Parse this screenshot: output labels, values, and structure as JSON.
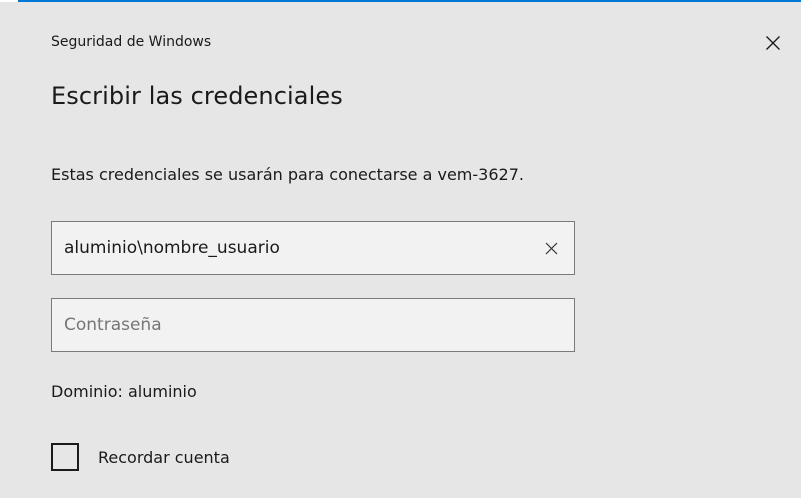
{
  "window": {
    "title": "Seguridad de Windows",
    "accent_color": "#0078d7",
    "close_icon": "close-icon"
  },
  "dialog": {
    "heading": "Escribir las credenciales",
    "description": "Estas credenciales se usarán para conectarse a vem-3627."
  },
  "username": {
    "value": "aluminio\\nombre_usuario",
    "clear_icon": "clear-icon"
  },
  "password": {
    "value": "",
    "placeholder": "Contraseña"
  },
  "domain": {
    "text": "Dominio: aluminio"
  },
  "remember": {
    "label": "Recordar cuenta",
    "checked": false
  }
}
